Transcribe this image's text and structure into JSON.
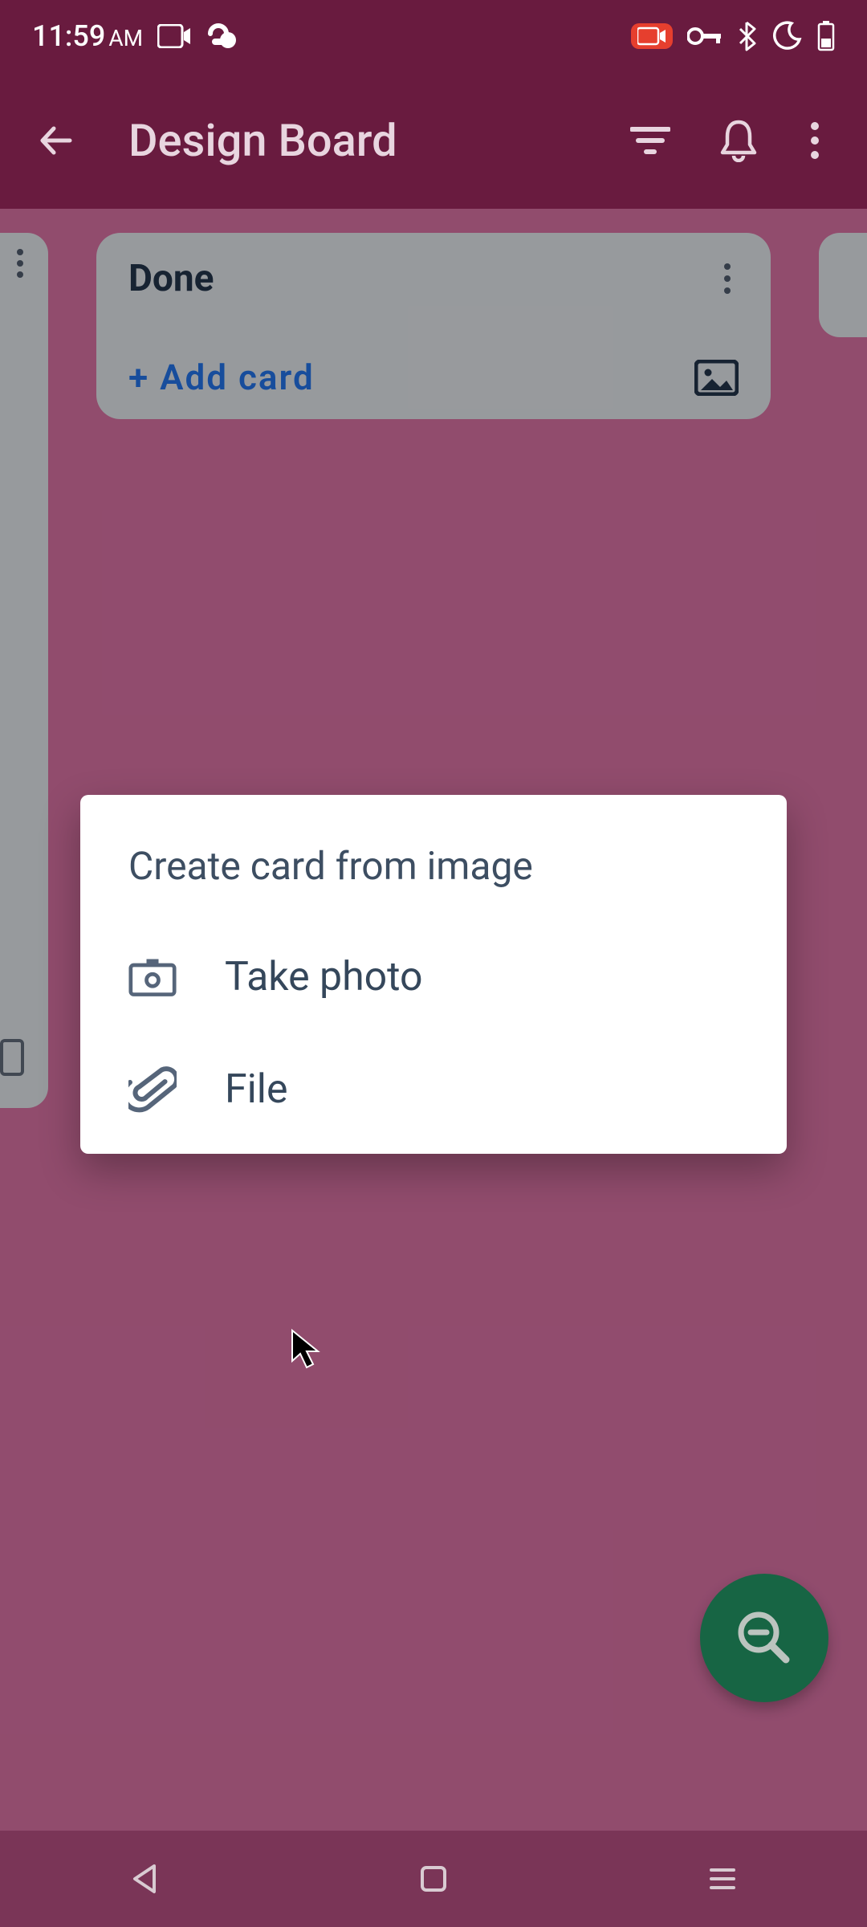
{
  "status": {
    "time": "11:59",
    "ampm": "AM"
  },
  "appbar": {
    "title": "Design Board"
  },
  "list": {
    "title": "Done",
    "add_card": "+ Add card"
  },
  "dialog": {
    "title": "Create card from image",
    "take_photo": "Take photo",
    "file": "File"
  }
}
